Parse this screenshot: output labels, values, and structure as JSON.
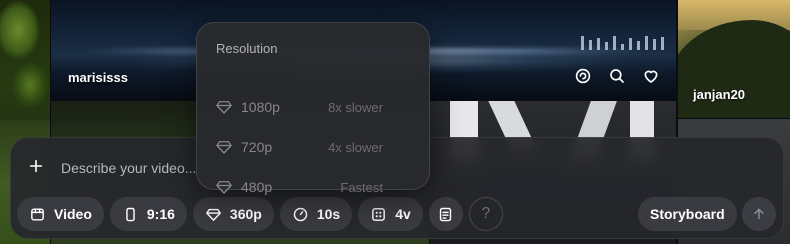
{
  "feed": {
    "tiles": [
      {
        "username": "marisisss"
      },
      {
        "username": "janjan20"
      }
    ],
    "actions": [
      {
        "icon": "remix-icon"
      },
      {
        "icon": "search-icon"
      },
      {
        "icon": "heart-icon"
      }
    ]
  },
  "composer": {
    "add_icon": "plus-icon",
    "prompt_placeholder": "Describe your video...",
    "prompt_value": "",
    "toolbar": {
      "type": {
        "icon": "video-icon",
        "label": "Video"
      },
      "aspect": {
        "icon": "portrait-icon",
        "label": "9:16"
      },
      "resolution": {
        "icon": "diamond-icon",
        "label": "360p"
      },
      "duration": {
        "icon": "timer-icon",
        "label": "10s"
      },
      "variations": {
        "icon": "grid-icon",
        "label": "4v"
      },
      "presets": {
        "icon": "preset-icon"
      },
      "help": {
        "label": "?"
      },
      "storyboard": {
        "label": "Storyboard"
      },
      "send": {
        "icon": "arrow-up-icon"
      }
    }
  },
  "resolution_menu": {
    "heading": "Resolution",
    "options": [
      {
        "label": "1080p",
        "speed": "8x slower"
      },
      {
        "label": "720p",
        "speed": "4x slower"
      },
      {
        "label": "480p",
        "speed": "Fastest"
      }
    ]
  },
  "colors": {
    "panel": "#26272b",
    "chip": "#3c3d42",
    "muted_text": "#86878c"
  }
}
